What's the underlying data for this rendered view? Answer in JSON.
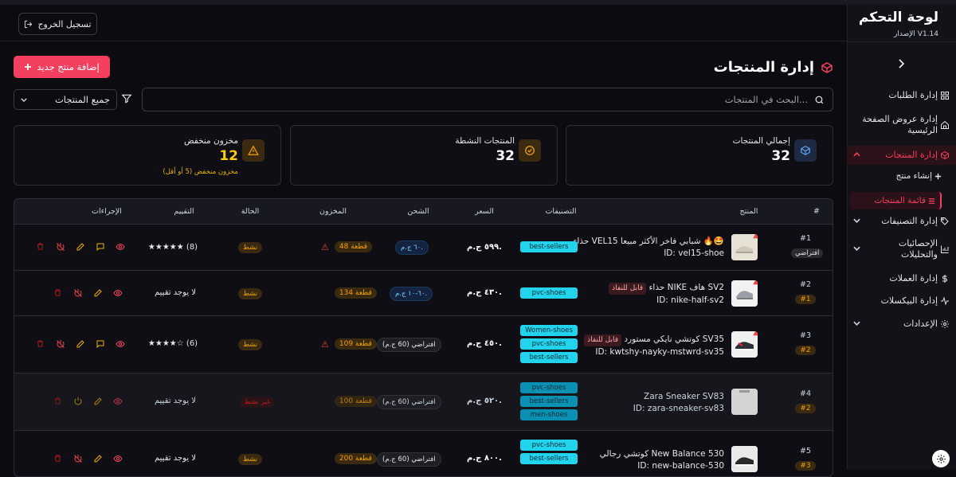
{
  "header": {
    "logout_label": "تسجيل الخروج"
  },
  "sidebar": {
    "title": "لوحة التحكم",
    "version": "الإصدار V1.14",
    "items": [
      {
        "label": "إدارة الطلبات",
        "icon": "grid-icon"
      },
      {
        "label": "إدارة عروض الصفحة الرئيسية",
        "icon": "home-icon"
      },
      {
        "label": "إدارة المنتجات",
        "icon": "box-icon"
      },
      {
        "label": "إنشاء منتج",
        "icon": "plus-icon"
      },
      {
        "label": "قائمة المنتجات",
        "icon": "list-icon"
      },
      {
        "label": "إدارة التصنيفات",
        "icon": "tag-icon"
      },
      {
        "label": "الإحصائيات والتحليلات",
        "icon": "chart-icon"
      },
      {
        "label": "إدارة العملات",
        "icon": "dollar-icon"
      },
      {
        "label": "إدارة البيكسلات",
        "icon": "pulse-icon"
      },
      {
        "label": "الإعدادات",
        "icon": "gear-icon"
      }
    ]
  },
  "page": {
    "title": "إدارة المنتجات",
    "add_button": "إضافة منتج جديد",
    "search_placeholder": "البحث في المنتجات...",
    "filter_value": "جميع المنتجات"
  },
  "stats": [
    {
      "title": "إجمالي المنتجات",
      "value": "32",
      "color": "#60a5fa"
    },
    {
      "title": "المنتجات النشطة",
      "value": "32",
      "color": "#f59e0b"
    },
    {
      "title": "مخزون منخفض",
      "value": "12",
      "sub": "مخزون منخفض (5 أو أقل)",
      "color": "#f59e0b"
    }
  ],
  "table": {
    "headers": [
      "#",
      "المنتج",
      "التصنيفات",
      "السعر",
      "الشحن",
      "المخزون",
      "الحالة",
      "التقييم",
      "الإجراءات"
    ],
    "rows": [
      {
        "num": "#1",
        "badge": "افتراضي",
        "name": "حذاء VEL15 شبابي فاخر الأكثر مبيعا 🔥🤩",
        "id": "ID: vel15-shoe",
        "tag": "",
        "cats": [
          "best-sellers"
        ],
        "price": "٥٩٩ ج.م.",
        "ship": "٦٠ ج.م.",
        "stock": "48 قطعة",
        "status": "نشط",
        "rating": "★★★★★ (8)"
      },
      {
        "num": "#2",
        "badge": "#1",
        "name": "حذاء NIKE هاف SV2",
        "id": "ID: nike-half-sv2",
        "tag": "قابل للنفاذ",
        "cats": [
          "pvc-shoes"
        ],
        "price": "٤٣٠ ج.م.",
        "ship": "٦٠-١٠ ج.م.",
        "stock": "134 قطعة",
        "status": "نشط",
        "rating": "لا يوجد تقييم"
      },
      {
        "num": "#3",
        "badge": "#2",
        "name": "كوتشي نايكي مستورد SV35",
        "id": "ID: kwtshy-nayky-mstwrd-sv35",
        "tag": "قابل للنفاذ",
        "cats": [
          "Women-shoes",
          "pvc-shoes",
          "best-sellers"
        ],
        "price": "٤٥٠ ج.م.",
        "ship": "افتراضي (60 ج.م)",
        "stock": "109 قطعة",
        "status": "نشط",
        "rating": "★★★★☆ (6)"
      },
      {
        "num": "#4",
        "badge": "#2",
        "name": "Zara Sneaker SV83",
        "id": "ID: zara-sneaker-sv83",
        "tag": "",
        "cats": [
          "pvc-shoes",
          "best-sellers",
          "men-shoes"
        ],
        "price": "٥٢٠ ج.م.",
        "ship": "افتراضي (60 ج.م)",
        "stock": "100 قطعة",
        "status": "غير نشط",
        "rating": "لا يوجد تقييم"
      },
      {
        "num": "#5",
        "badge": "#3",
        "name": "كوتشي رجالي New Balance 530",
        "id": "ID: new-balance-530",
        "tag": "",
        "cats": [
          "pvc-shoes",
          "best-sellers"
        ],
        "price": "٨٠٠ ج.م.",
        "ship": "افتراضي (60 ج.م)",
        "stock": "200 قطعة",
        "status": "نشط",
        "rating": "لا يوجد تقييم"
      }
    ]
  }
}
